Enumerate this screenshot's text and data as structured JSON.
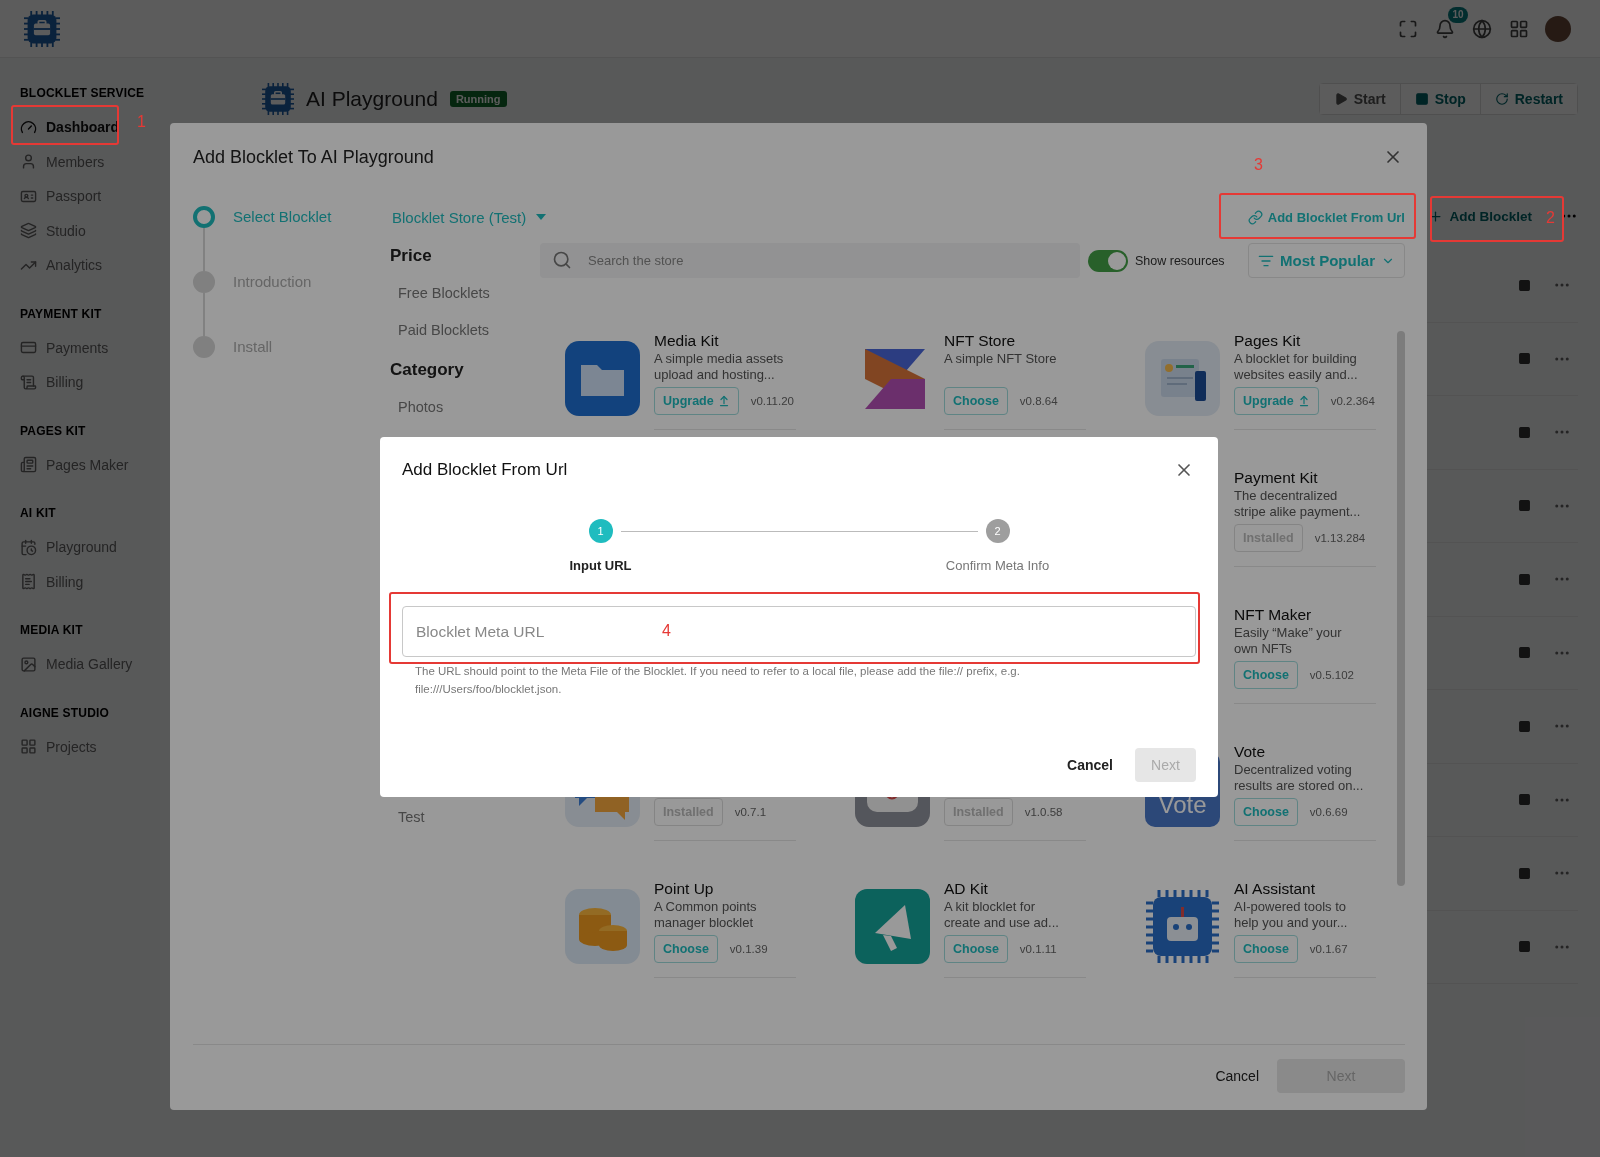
{
  "topbar": {
    "notification_count": "10"
  },
  "sidebar": [
    {
      "title": "BLOCKLET SERVICE",
      "items": [
        {
          "label": "Dashboard",
          "selected": true
        },
        {
          "label": "Members",
          "selected": false
        },
        {
          "label": "Passport",
          "selected": false
        },
        {
          "label": "Studio",
          "selected": false
        },
        {
          "label": "Analytics",
          "selected": false
        }
      ]
    },
    {
      "title": "PAYMENT KIT",
      "items": [
        {
          "label": "Payments",
          "selected": false
        },
        {
          "label": "Billing",
          "selected": false
        }
      ]
    },
    {
      "title": "PAGES KIT",
      "items": [
        {
          "label": "Pages Maker",
          "selected": false
        }
      ]
    },
    {
      "title": "AI KIT",
      "items": [
        {
          "label": "Playground",
          "selected": false
        },
        {
          "label": "Billing",
          "selected": false
        }
      ]
    },
    {
      "title": "MEDIA KIT",
      "items": [
        {
          "label": "Media Gallery",
          "selected": false
        }
      ]
    },
    {
      "title": "AIGNE STUDIO",
      "items": [
        {
          "label": "Projects",
          "selected": false
        }
      ]
    }
  ],
  "app": {
    "title": "AI Playground",
    "status": "Running",
    "actions": [
      {
        "label": "Start",
        "disabled": true
      },
      {
        "label": "Stop",
        "disabled": false
      },
      {
        "label": "Restart",
        "disabled": false
      }
    ]
  },
  "components": {
    "add_button": "Add Blocklet",
    "rows": [
      {
        "kind": "component"
      },
      {
        "kind": "component"
      },
      {
        "kind": "component"
      },
      {
        "kind": "component"
      },
      {
        "kind": "component"
      },
      {
        "kind": "component"
      },
      {
        "kind": "component"
      },
      {
        "kind": "component"
      },
      {
        "kind": "component"
      },
      {
        "kind": "component"
      }
    ]
  },
  "store_dialog": {
    "title": "Add Blocklet To AI Playground",
    "steps": [
      {
        "label": "Select Blocklet",
        "active": true
      },
      {
        "label": "Introduction",
        "active": false
      },
      {
        "label": "Install",
        "active": false
      }
    ],
    "store": "Blocklet Store (Test)",
    "from_url_button": "Add Blocklet From Url",
    "filters": [
      {
        "title": "Price",
        "items": [
          {
            "label": "Free Blocklets"
          },
          {
            "label": "Paid Blocklets"
          }
        ]
      },
      {
        "title": "Category",
        "items": [
          {
            "label": "Photos"
          },
          {
            "kind": "covered"
          },
          {
            "label": "Test"
          }
        ]
      }
    ],
    "search": {
      "placeholder": "Search the store"
    },
    "show_resources": {
      "label": "Show resources",
      "on": true
    },
    "sort": "Most Popular",
    "cards": [
      {
        "kind": "card",
        "name": "Media Kit",
        "description": "A simple media assets\nupload and hosting...",
        "action": {
          "label": "Upgrade",
          "kind": "upgrade"
        },
        "version": "v0.11.20"
      },
      {
        "kind": "card",
        "name": "NFT Store",
        "description": "A simple NFT Store",
        "action": {
          "label": "Choose",
          "kind": "choose"
        },
        "version": "v0.8.64"
      },
      {
        "kind": "card",
        "name": "Pages Kit",
        "description": "A blocklet for building\nwebsites easily and...",
        "action": {
          "label": "Upgrade",
          "kind": "upgrade"
        },
        "version": "v0.2.364"
      },
      {
        "kind": "covered"
      },
      {
        "kind": "covered"
      },
      {
        "kind": "card",
        "name": "Payment Kit",
        "description": "The decentralized\nstripe alike payment...",
        "action": {
          "label": "Installed",
          "kind": "installed"
        },
        "version": "v1.13.284"
      },
      {
        "kind": "covered"
      },
      {
        "kind": "covered"
      },
      {
        "kind": "card",
        "name": "NFT Maker",
        "description": "Easily “Make” your\nown NFTs",
        "action": {
          "label": "Choose",
          "kind": "choose"
        },
        "version": "v0.5.102"
      },
      {
        "kind": "partial",
        "action": {
          "label": "Installed",
          "kind": "installed"
        },
        "version": "v0.7.1"
      },
      {
        "kind": "partial",
        "action": {
          "label": "Installed",
          "kind": "installed"
        },
        "version": "v1.0.58"
      },
      {
        "kind": "card",
        "name": "Vote",
        "description": "Decentralized voting\nresults are stored on...",
        "icon_text": "Vote",
        "action": {
          "label": "Choose",
          "kind": "choose"
        },
        "version": "v0.6.69"
      },
      {
        "kind": "card",
        "name": "Point Up",
        "description": "A Common points\nmanager blocklet",
        "action": {
          "label": "Choose",
          "kind": "choose"
        },
        "version": "v0.1.39"
      },
      {
        "kind": "card",
        "name": "AD Kit",
        "description": "A kit blocklet for\ncreate and use ad...",
        "action": {
          "label": "Choose",
          "kind": "choose"
        },
        "version": "v0.1.11"
      },
      {
        "kind": "card",
        "name": "AI Assistant",
        "description": "AI-powered tools to\nhelp you and your...",
        "action": {
          "label": "Choose",
          "kind": "choose"
        },
        "version": "v0.1.67"
      }
    ],
    "footer": {
      "cancel": "Cancel",
      "next": "Next",
      "next_disabled": true
    }
  },
  "url_dialog": {
    "title": "Add Blocklet From Url",
    "steps": [
      {
        "number": "1",
        "label": "Input URL",
        "active": true
      },
      {
        "number": "2",
        "label": "Confirm Meta Info",
        "active": false
      }
    ],
    "field": {
      "placeholder": "Blocklet Meta URL"
    },
    "helper": "The URL should point to the Meta File of the Blocklet. If you need to refer to a local file, please add the file:// prefix, e.g. file:///Users/foo/blocklet.json.",
    "cancel": "Cancel",
    "next": "Next",
    "next_disabled": true
  },
  "annotations": [
    {
      "label": "1"
    },
    {
      "label": "2"
    },
    {
      "label": "3"
    },
    {
      "label": "4"
    }
  ]
}
